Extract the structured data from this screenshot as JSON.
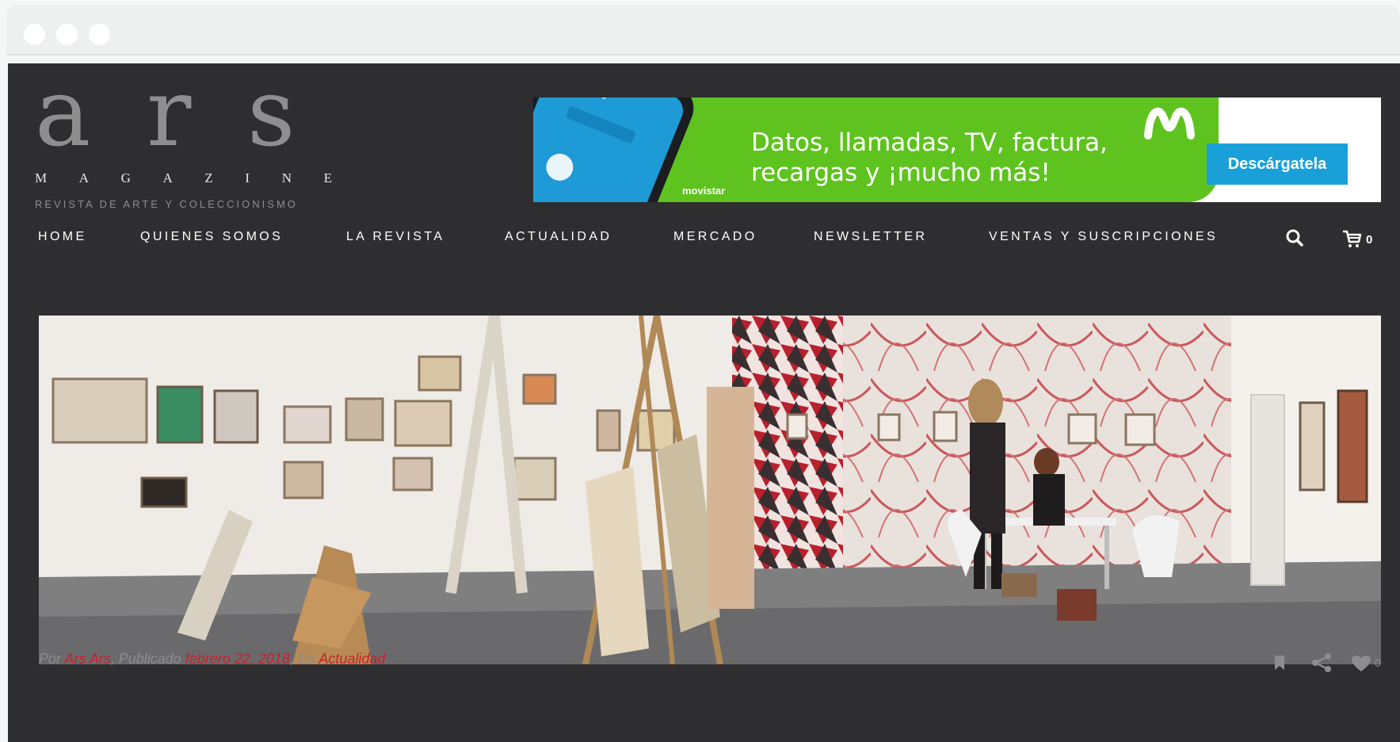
{
  "logo": {
    "letters": [
      "a",
      "r",
      "s"
    ],
    "magazine": [
      "M",
      "A",
      "G",
      "A",
      "Z",
      "I",
      "N",
      "E"
    ],
    "tagline": "REVISTA DE ARTE Y COLECCIONISMO"
  },
  "banner": {
    "brand": "movistar",
    "line1": "Datos, llamadas, TV, factura,",
    "line2": "recargas y ¡mucho más!",
    "cta": "Descárgatela",
    "colors": {
      "green": "#5ec31e",
      "blue": "#1aa0d8"
    }
  },
  "nav": {
    "items": [
      "HOME",
      "QUIENES SOMOS",
      "LA REVISTA",
      "ACTUALIDAD",
      "MERCADO",
      "NEWSLETTER",
      "VENTAS Y SUSCRIPCIONES"
    ],
    "cart_count": "0"
  },
  "post": {
    "by_label": "Por",
    "author": "Ars Ars",
    "published_label": "Publicado",
    "date": "febrero 22, 2018",
    "in_label": "En",
    "category": "Actualidad",
    "like_count": "0",
    "accent": "#c8202b"
  },
  "icons": [
    "search-icon",
    "cart-icon",
    "bookmark-icon",
    "share-icon",
    "heart-icon"
  ]
}
